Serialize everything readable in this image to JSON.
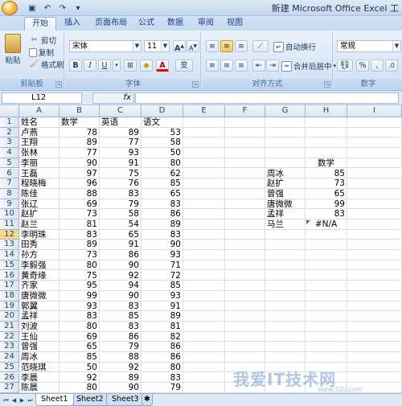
{
  "window": {
    "title": "新建 Microsoft Office Excel 工"
  },
  "ribbon": {
    "tabs": [
      "开始",
      "插入",
      "页面布局",
      "公式",
      "数据",
      "审阅",
      "视图"
    ],
    "clipboard": {
      "paste": "粘贴",
      "cut": "剪切",
      "copy": "复制",
      "format_painter": "格式刷",
      "label": "剪贴板"
    },
    "font": {
      "name": "宋体",
      "size": "11",
      "grow": "A",
      "shrink": "A",
      "bold": "B",
      "italic": "I",
      "underline": "U",
      "label": "字体",
      "wen": "变"
    },
    "alignment": {
      "wrap": "自动换行",
      "merge": "合并后居中",
      "label": "对齐方式"
    },
    "number": {
      "format": "常规",
      "percent": "%",
      "comma": ",",
      "label": "数字"
    }
  },
  "formula_bar": {
    "name_box": "L12",
    "fx": "fx",
    "value": ""
  },
  "grid": {
    "columns": [
      "A",
      "B",
      "C",
      "D",
      "E",
      "F",
      "G",
      "H",
      "I"
    ],
    "rows": [
      "1",
      "2",
      "3",
      "4",
      "5",
      "6",
      "7",
      "8",
      "9",
      "10",
      "11",
      "12",
      "13",
      "14",
      "15",
      "16",
      "17",
      "18",
      "19",
      "20",
      "21",
      "22",
      "23",
      "24",
      "25",
      "26",
      "27"
    ],
    "selected_row": "12",
    "table": [
      [
        "姓名",
        "数学",
        "英语",
        "语文"
      ],
      [
        "卢燕",
        "78",
        "89",
        "53"
      ],
      [
        "王翔",
        "89",
        "77",
        "58"
      ],
      [
        "张林",
        "77",
        "93",
        "50"
      ],
      [
        "李丽",
        "90",
        "91",
        "80"
      ],
      [
        "王磊",
        "97",
        "75",
        "62"
      ],
      [
        "程晓梅",
        "96",
        "76",
        "85"
      ],
      [
        "陈佳",
        "88",
        "83",
        "65"
      ],
      [
        "张辽",
        "69",
        "79",
        "83"
      ],
      [
        "赵扩",
        "73",
        "58",
        "86"
      ],
      [
        "赵兰",
        "81",
        "54",
        "89"
      ],
      [
        "李明珠",
        "83",
        "65",
        "83"
      ],
      [
        "田秀",
        "89",
        "91",
        "90"
      ],
      [
        "孙方",
        "73",
        "86",
        "93"
      ],
      [
        "李毅强",
        "80",
        "90",
        "71"
      ],
      [
        "黄奇缘",
        "75",
        "92",
        "72"
      ],
      [
        "齐家",
        "95",
        "94",
        "85"
      ],
      [
        "唐微微",
        "99",
        "90",
        "93"
      ],
      [
        "郭翼",
        "93",
        "83",
        "91"
      ],
      [
        "孟祥",
        "83",
        "85",
        "89"
      ],
      [
        "刘波",
        "80",
        "83",
        "81"
      ],
      [
        "王仙",
        "69",
        "86",
        "82"
      ],
      [
        "曾强",
        "65",
        "79",
        "86"
      ],
      [
        "周冰",
        "85",
        "88",
        "86"
      ],
      [
        "范晓琪",
        "50",
        "92",
        "80"
      ],
      [
        "李晨",
        "92",
        "89",
        "83"
      ],
      [
        "陈晨",
        "80",
        "90",
        "79"
      ]
    ],
    "lookup_header": "数学",
    "lookup": [
      [
        "周冰",
        "85"
      ],
      [
        "赵扩",
        "73"
      ],
      [
        "曾强",
        "65"
      ],
      [
        "唐微微",
        "99"
      ],
      [
        "孟祥",
        "83"
      ],
      [
        "马兰",
        "#N/A"
      ]
    ]
  },
  "sheets": [
    "Sheet1",
    "Sheet2",
    "Sheet3"
  ],
  "watermark": {
    "text": "我爱IT技术网",
    "url": "www.52ij.com"
  }
}
